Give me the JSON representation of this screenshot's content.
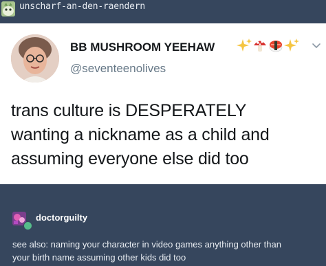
{
  "reblog": {
    "username": "unscharf-an-den-raendern"
  },
  "tweet": {
    "display_name": "BB MUSHROOM YEEHAW",
    "name_emoji": [
      "✨",
      "🍄",
      "🍣",
      "✨"
    ],
    "handle": "@seventeenolives",
    "lines": [
      "trans culture is DESPERATELY",
      "wanting a nickname as a child and",
      "assuming everyone else did too"
    ]
  },
  "reply": {
    "username": "doctorguilty",
    "lines": [
      "see also: naming your character in video games anything other than",
      "your birth name assuming other kids did too"
    ]
  },
  "colors": {
    "dashboard_bg": "#36465d",
    "card_bg": "#ffffff",
    "handle_gray": "#657786",
    "badge_green": "#56bc8a"
  },
  "icons": {
    "reblog_avatar": "cartoon-creature-avatar",
    "tweet_avatar": "person-with-glasses-avatar",
    "chevron": "chevron-down-icon",
    "reply_avatar": "pink-art-avatar",
    "reply_badge": "reblog-badge-icon"
  }
}
